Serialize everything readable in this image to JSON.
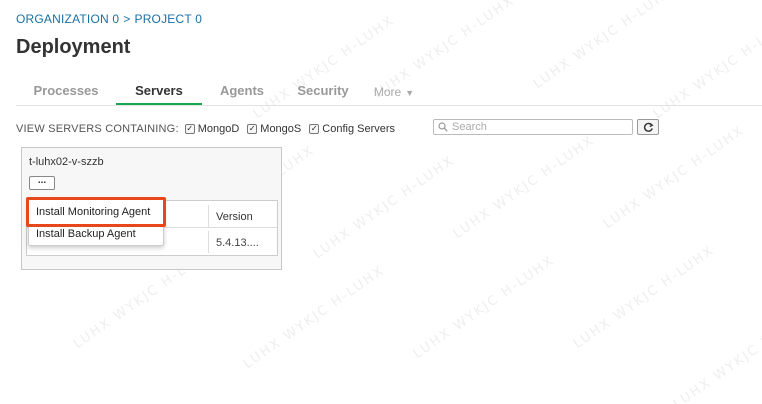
{
  "breadcrumb": {
    "organization": "ORGANIZATION 0",
    "separator": ">",
    "project": "PROJECT 0"
  },
  "page_title": "Deployment",
  "tabs": [
    {
      "label": "Processes",
      "active": false
    },
    {
      "label": "Servers",
      "active": true
    },
    {
      "label": "Agents",
      "active": false
    },
    {
      "label": "Security",
      "active": false
    },
    {
      "label": "More",
      "active": false
    }
  ],
  "filter": {
    "label": "VIEW SERVERS CONTAINING:",
    "options": [
      {
        "label": "MongoD",
        "checked": true
      },
      {
        "label": "MongoS",
        "checked": true
      },
      {
        "label": "Config Servers",
        "checked": true
      }
    ],
    "checkmark": "✓"
  },
  "search": {
    "placeholder": "Search",
    "value": ""
  },
  "server_card": {
    "name": "t-luhx02-v-szzb",
    "menu_button": "...",
    "table": {
      "header_version": "Version",
      "row_version": "5.4.13...."
    }
  },
  "dropdown": {
    "items": [
      "Install Monitoring Agent",
      "Install Backup Agent"
    ]
  },
  "colors": {
    "accent": "#13aa52",
    "link": "#1a6fa3",
    "highlight": "#e8471c"
  },
  "watermark": "LUHX WYKJC H-LUHX"
}
